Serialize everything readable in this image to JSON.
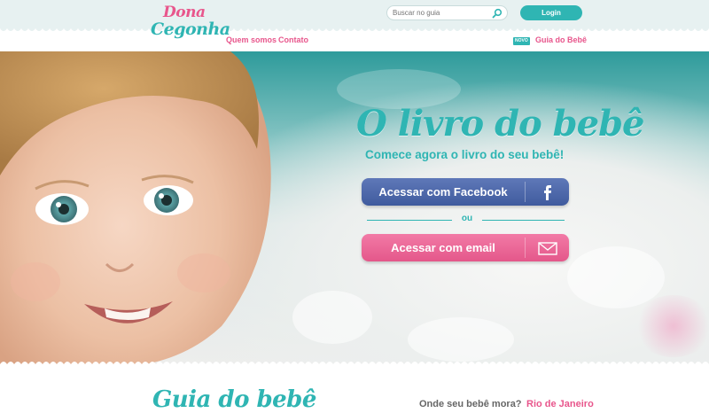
{
  "header": {
    "logo_line1": "Dona",
    "logo_line2": "Cegonha",
    "search_placeholder": "Buscar no guia",
    "login_label": "Login",
    "nav": [
      "Quem somos",
      "Contato"
    ],
    "new_badge": "NOVO",
    "guide_link": "Guia do Bebê"
  },
  "hero": {
    "title": "O livro do bebê",
    "subtitle": "Comece agora o livro do seu bebê!",
    "facebook_button": "Acessar com Facebook",
    "divider_text": "ou",
    "email_button": "Acessar com email"
  },
  "guide": {
    "title": "Guia do bebê",
    "question": "Onde seu bebê mora?",
    "city": "Rio de Janeiro"
  },
  "colors": {
    "teal": "#2fb5b3",
    "pink": "#e8568c",
    "facebook_blue": "#4a66aa",
    "email_pink": "#ec6a98"
  }
}
